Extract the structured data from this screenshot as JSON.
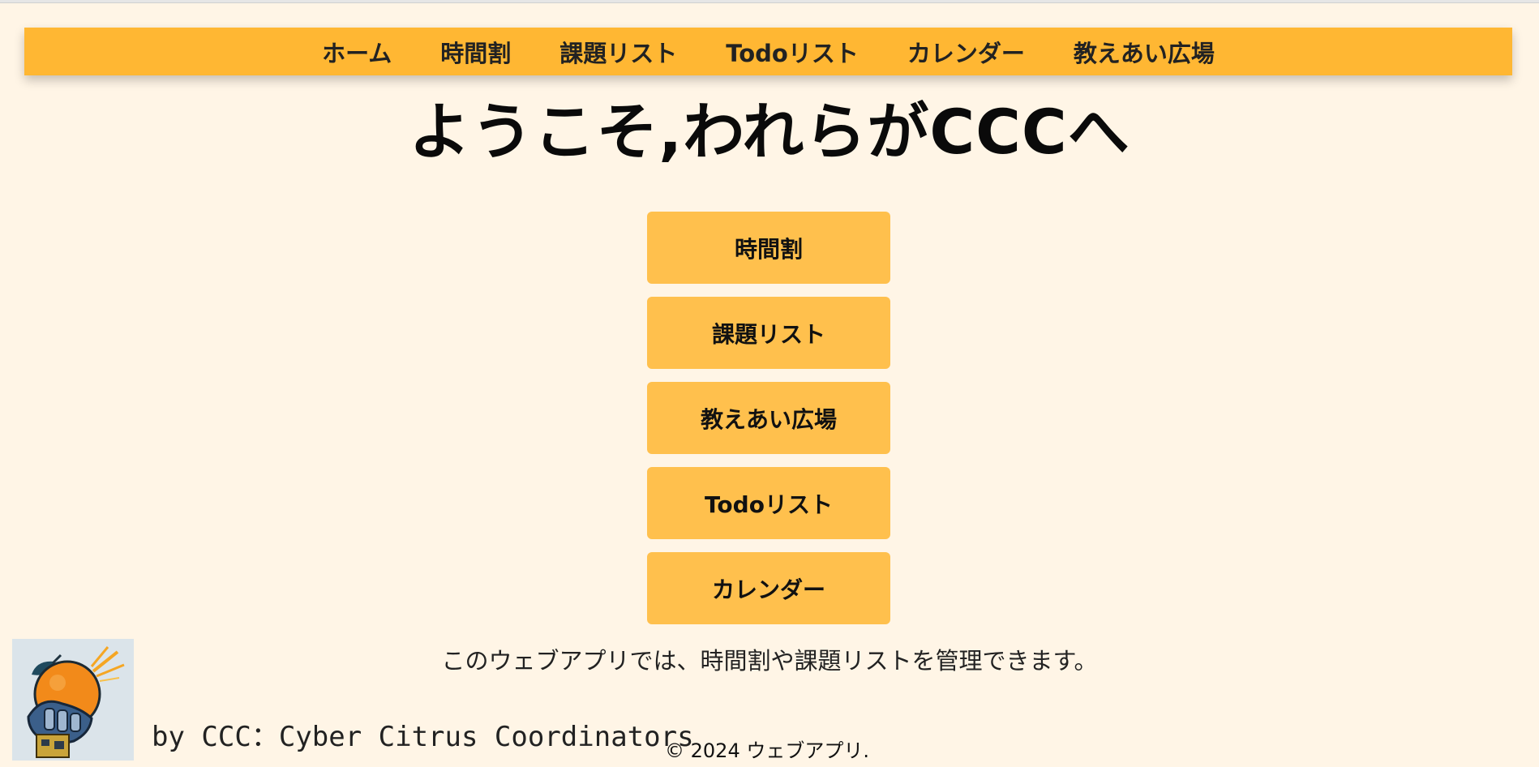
{
  "nav": {
    "items": [
      {
        "label": "ホーム"
      },
      {
        "label": "時間割"
      },
      {
        "label": "課題リスト"
      },
      {
        "label": "Todoリスト"
      },
      {
        "label": "カレンダー"
      },
      {
        "label": "教えあい広場"
      }
    ]
  },
  "main": {
    "title": "ようこそ,われらがCCCへ",
    "buttons": [
      {
        "label": "時間割"
      },
      {
        "label": "課題リスト"
      },
      {
        "label": "教えあい広場"
      },
      {
        "label": "Todoリスト"
      },
      {
        "label": "カレンダー"
      }
    ],
    "description": "このウェブアプリでは、時間割や課題リストを管理できます。"
  },
  "footer": {
    "logo_icon": "orange-robot-logo-icon",
    "byline": "by CCC：Cyber Citrus Coordinators",
    "copyright": "© 2024 ウェブアプリ."
  },
  "colors": {
    "background": "#fff5e6",
    "navbar": "#ffb733",
    "button": "#ffc04d",
    "text": "#111111"
  }
}
